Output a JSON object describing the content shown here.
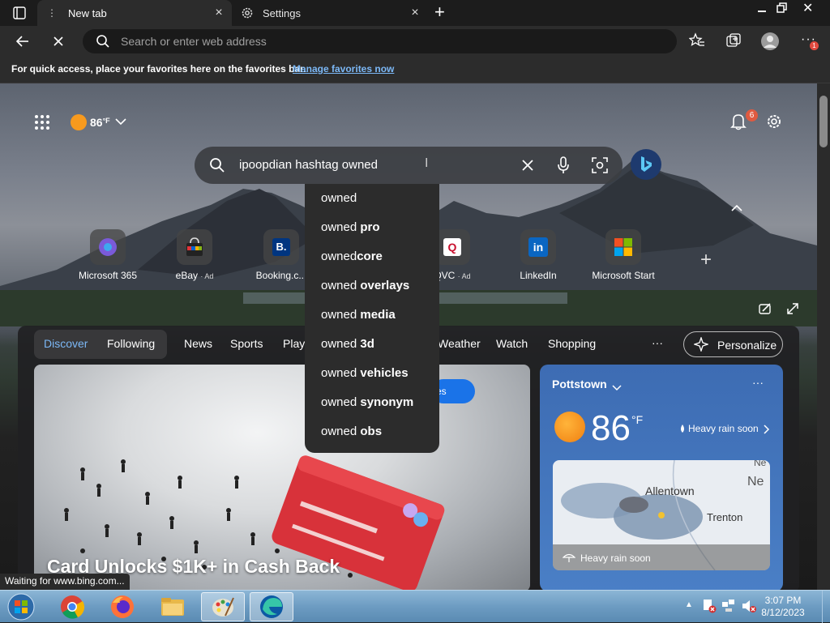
{
  "browser": {
    "tabs": [
      {
        "label": "New tab"
      },
      {
        "label": "Settings"
      }
    ],
    "address_placeholder": "Search or enter web address",
    "favbar_message": "For quick access, place your favorites here on the favorites bar.",
    "favbar_link": "Manage favorites now",
    "status": "Waiting for www.bing.com...",
    "notification_badge": "1"
  },
  "newtab": {
    "weather_temp": "86",
    "weather_unit": "°F",
    "notification_count": "6",
    "search_query": "ipoopdian hashtag owned",
    "suggestions": [
      {
        "prefix": "owned",
        "rest": ""
      },
      {
        "prefix": "owned ",
        "rest": "pro"
      },
      {
        "prefix": "owned",
        "rest": "core"
      },
      {
        "prefix": "owned ",
        "rest": "overlays"
      },
      {
        "prefix": "owned ",
        "rest": "media"
      },
      {
        "prefix": "owned ",
        "rest": "3d"
      },
      {
        "prefix": "owned ",
        "rest": "vehicles"
      },
      {
        "prefix": "owned ",
        "rest": "synonym"
      },
      {
        "prefix": "owned ",
        "rest": "obs"
      }
    ],
    "quicklinks": [
      {
        "label": "Microsoft 365",
        "ad": ""
      },
      {
        "label": "eBay",
        "ad": "· Ad"
      },
      {
        "label": "Booking.c...",
        "ad": ""
      },
      {
        "label": "QVC",
        "ad": "· Ad"
      },
      {
        "label": "LinkedIn",
        "ad": ""
      },
      {
        "label": "Microsoft Start",
        "ad": ""
      }
    ],
    "feed_tabs": [
      "Discover",
      "Following",
      "News",
      "Sports",
      "Play",
      "Weather",
      "Watch",
      "Shopping"
    ],
    "more": "···",
    "personalize": "Personalize",
    "story_headline": "Card Unlocks $1K+ in Cash Back",
    "story_button": "es",
    "weather_card": {
      "location": "Pottstown",
      "temp": "86",
      "unit": "°F",
      "condition": "Heavy rain soon",
      "map_condition": "Heavy rain soon",
      "map_labels": [
        "Allentown",
        "Trenton",
        "Ne",
        "Ne"
      ]
    }
  },
  "taskbar": {
    "time": "3:07 PM",
    "date": "8/12/2023"
  },
  "colors": {
    "accent": "#7cb8f6",
    "tab_active": "#2c2c2c",
    "weather_sun": "#f79a1e"
  }
}
